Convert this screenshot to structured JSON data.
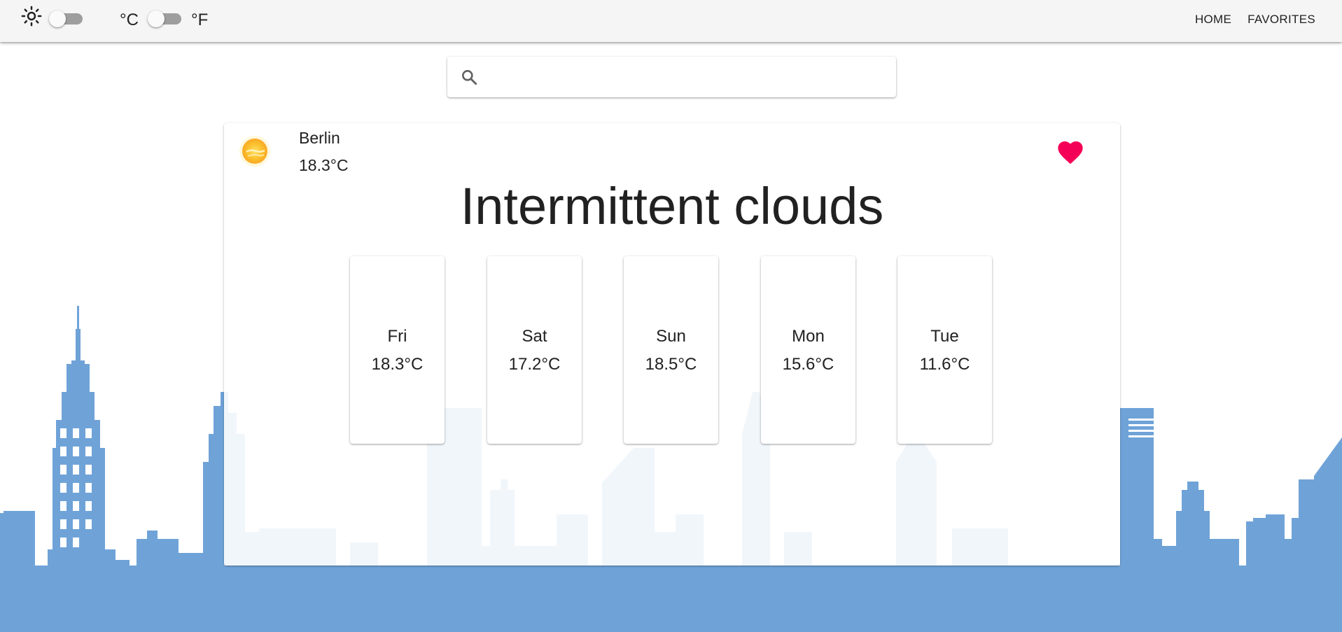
{
  "header": {
    "theme_toggle": {
      "light_icon": "sun-icon",
      "dark_icon": "moon-icon",
      "checked": false
    },
    "unit_toggle": {
      "celsius_label": "°C",
      "fahrenheit_label": "°F",
      "checked": false
    },
    "nav": {
      "home_label": "HOME",
      "favorites_label": "FAVORITES"
    }
  },
  "search": {
    "value": "",
    "placeholder": "",
    "icon": "search-icon"
  },
  "weather": {
    "city": "Berlin",
    "current_temp": "18.3°C",
    "condition": "Intermittent clouds",
    "icon": "sun-with-clouds-icon",
    "favorite": true,
    "forecast": [
      {
        "day": "Fri",
        "temp": "18.3°C"
      },
      {
        "day": "Sat",
        "temp": "17.2°C"
      },
      {
        "day": "Sun",
        "temp": "18.5°C"
      },
      {
        "day": "Mon",
        "temp": "15.6°C"
      },
      {
        "day": "Tue",
        "temp": "11.6°C"
      }
    ]
  },
  "colors": {
    "skyline_blue": "#6fa3d8",
    "heart": "#f50057",
    "topbar_bg": "#f5f5f5",
    "switch_track": "#9e9e9e"
  }
}
